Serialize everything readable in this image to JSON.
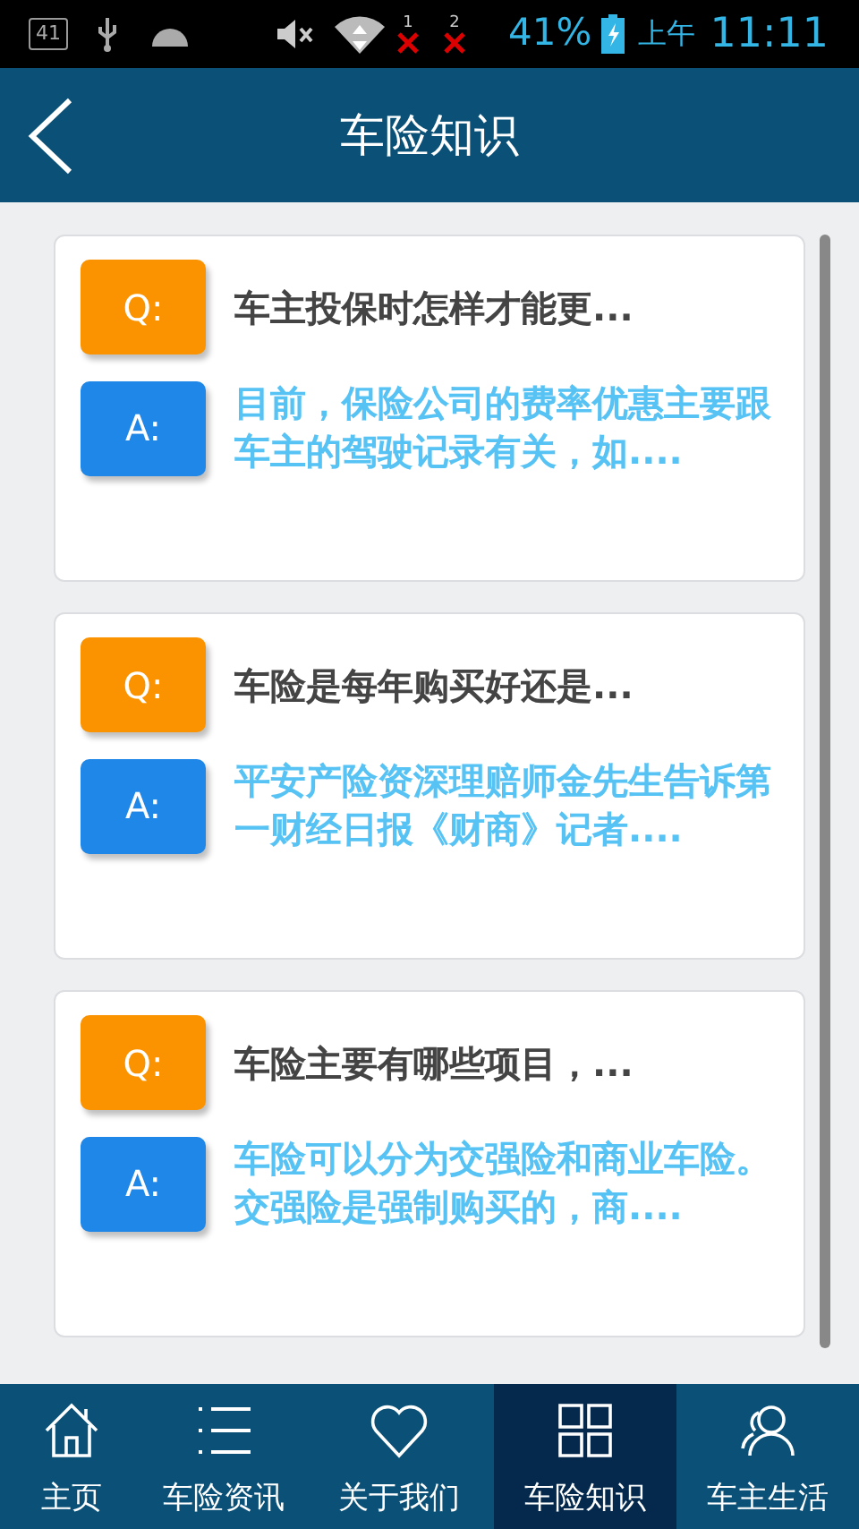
{
  "status_bar": {
    "notification_count": "41",
    "sim_1": "1",
    "sim_2": "2",
    "battery": "41%",
    "period": "上午",
    "time": "11:11"
  },
  "header": {
    "title": "车险知识"
  },
  "faq": [
    {
      "q_label": "Q:",
      "question": "车主投保时怎样才能更...",
      "a_label": "A:",
      "answer": "目前，保险公司的费率优惠主要跟车主的驾驶记录有关，如...."
    },
    {
      "q_label": "Q:",
      "question": "车险是每年购买好还是...",
      "a_label": "A:",
      "answer": "平安产险资深理赔师金先生告诉第一财经日报《财商》记者...."
    },
    {
      "q_label": "Q:",
      "question": "车险主要有哪些项目，...",
      "a_label": "A:",
      "answer": "车险可以分为交强险和商业车险。交强险是强制购买的，商...."
    }
  ],
  "bottom_nav": [
    {
      "kind": "home",
      "label": "主页",
      "selected": false
    },
    {
      "kind": "list",
      "label": "车险资讯",
      "selected": false
    },
    {
      "kind": "heart",
      "label": "关于我们",
      "selected": false
    },
    {
      "kind": "grid",
      "label": "车险知识",
      "selected": true
    },
    {
      "kind": "people",
      "label": "车主生活",
      "selected": false
    }
  ]
}
